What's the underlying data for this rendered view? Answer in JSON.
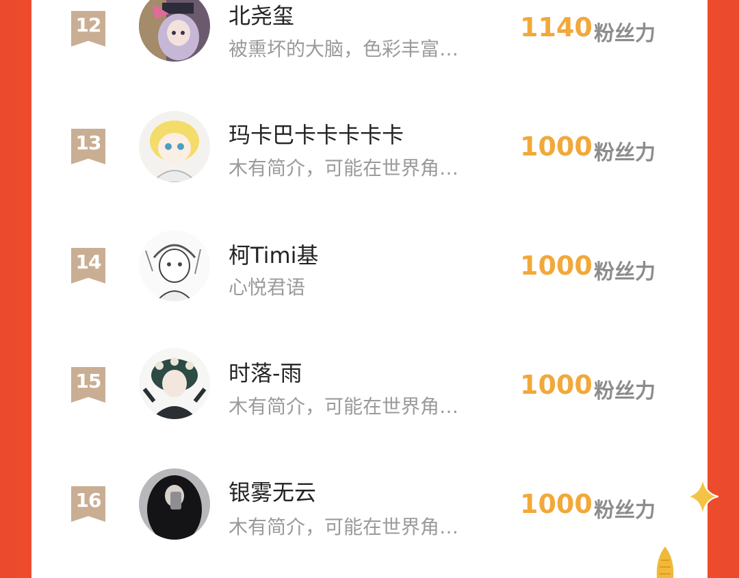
{
  "ranking": {
    "entries": [
      {
        "rank": "12",
        "name": "北尧玺",
        "bio": "被熏坏的大脑，色彩丰富…",
        "score": "1140",
        "unit": "粉丝力"
      },
      {
        "rank": "13",
        "name": "玛卡巴卡卡卡卡卡",
        "bio": "木有简介，可能在世界角…",
        "score": "1000",
        "unit": "粉丝力"
      },
      {
        "rank": "14",
        "name": "柯Timi基",
        "bio": "心悦君语",
        "score": "1000",
        "unit": "粉丝力"
      },
      {
        "rank": "15",
        "name": "时落-雨",
        "bio": "木有简介，可能在世界角…",
        "score": "1000",
        "unit": "粉丝力"
      },
      {
        "rank": "16",
        "name": "银雾无云",
        "bio": "木有简介，可能在世界角…",
        "score": "1000",
        "unit": "粉丝力"
      }
    ]
  },
  "colors": {
    "background": "#ec4a2c",
    "rank_badge": "#c9ae94",
    "score": "#f2a83a",
    "unit": "#8c8c8c"
  },
  "icons": {
    "sparkle": "sparkle-icon",
    "decoration": "gold-decoration-icon"
  }
}
